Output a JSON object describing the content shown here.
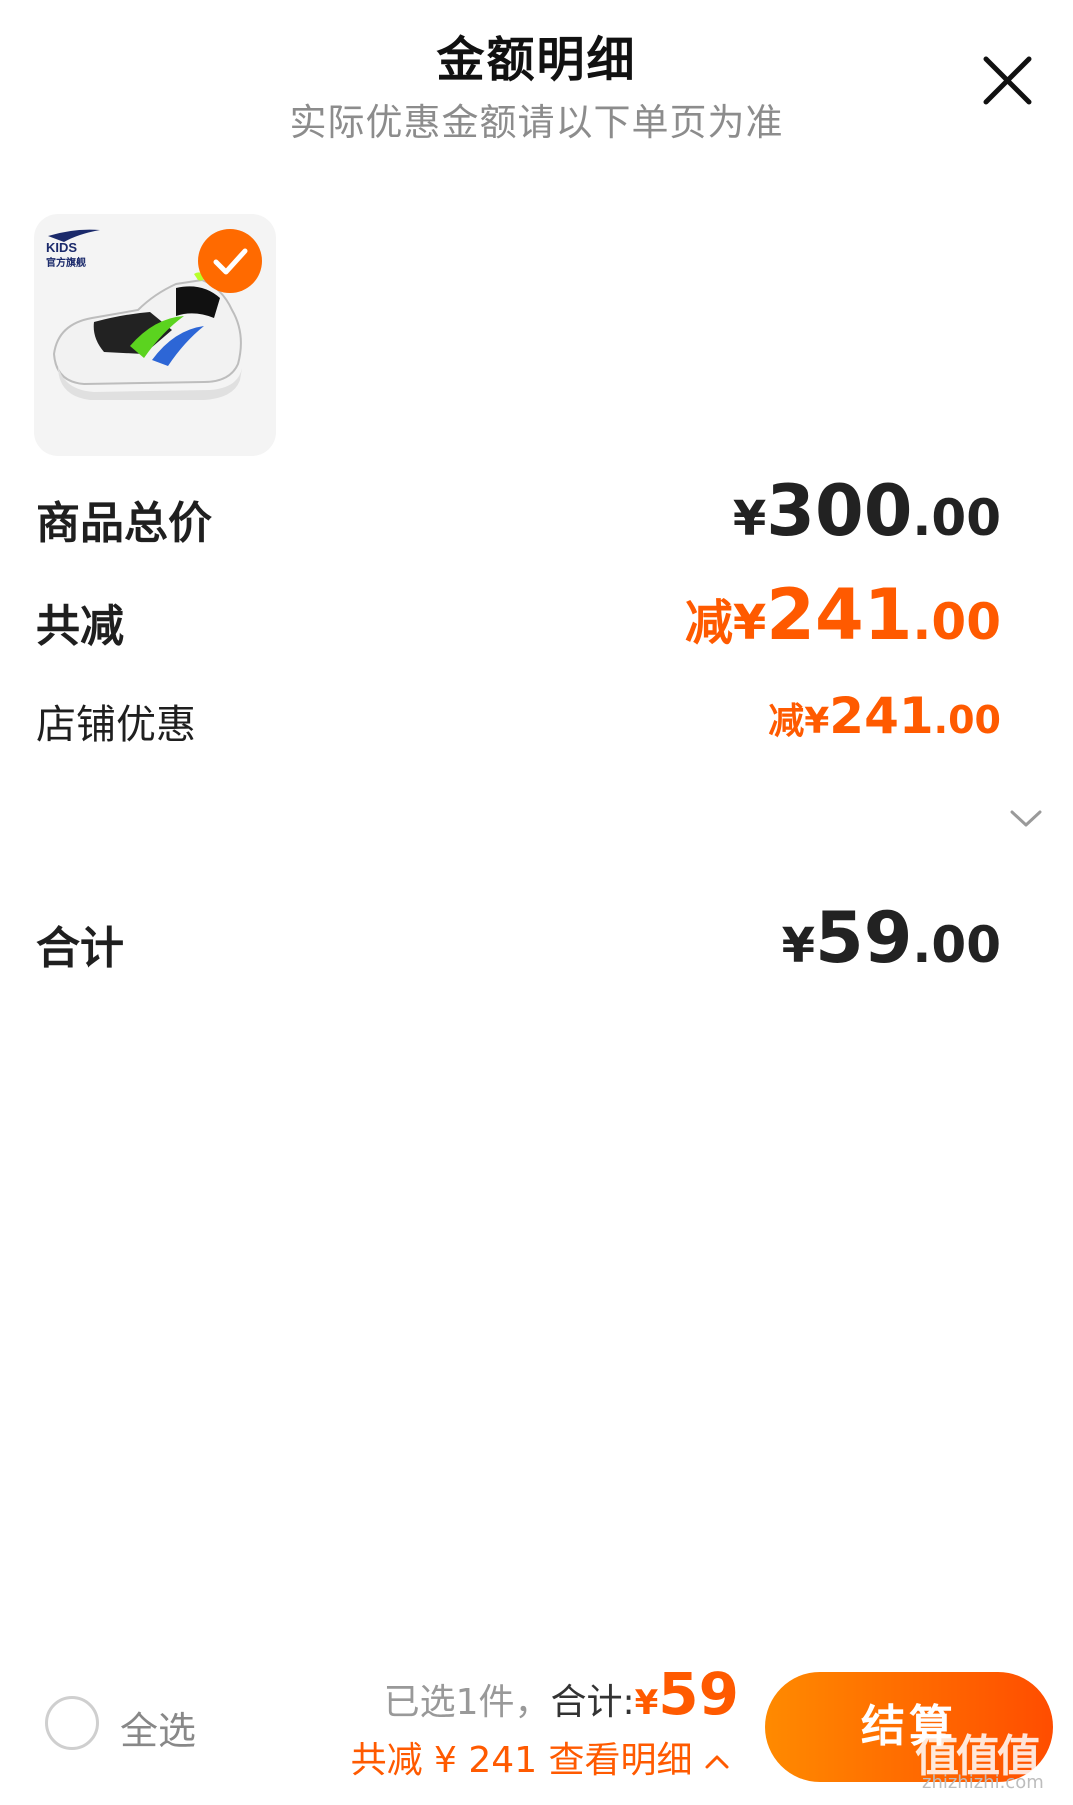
{
  "header": {
    "title": "金额明细",
    "subtitle": "实际优惠金额请以下单页为准",
    "close_icon": "close-icon"
  },
  "product": {
    "brand_text": "KIDS",
    "brand_sub": "官方旗舰",
    "selected": true
  },
  "rows": {
    "total_price": {
      "label": "商品总价",
      "yen": "¥",
      "int": "300",
      "dec": ".00"
    },
    "total_discount": {
      "label": "共减",
      "prefix": "减¥",
      "int": "241",
      "dec": ".00"
    },
    "shop_discount": {
      "label": "店铺优惠",
      "prefix": "减¥",
      "int": "241",
      "dec": ".00",
      "icon": "chevron-down-icon"
    },
    "sum": {
      "label": "合计",
      "yen": "¥",
      "int": "59",
      "dec": ".00"
    }
  },
  "footer": {
    "select_all": "全选",
    "selected_count": "已选1件，",
    "sum_label": "合计:",
    "sum_yen": "¥",
    "sum_value": "59",
    "discount_text": "共减 ¥ 241 查看明细",
    "checkout_label": "结算",
    "watermark": "值值值",
    "watermark_sub": "zhizhizhi.com"
  },
  "colors": {
    "accent": "#ff5a00",
    "subtitle": "#8c8c8c"
  }
}
